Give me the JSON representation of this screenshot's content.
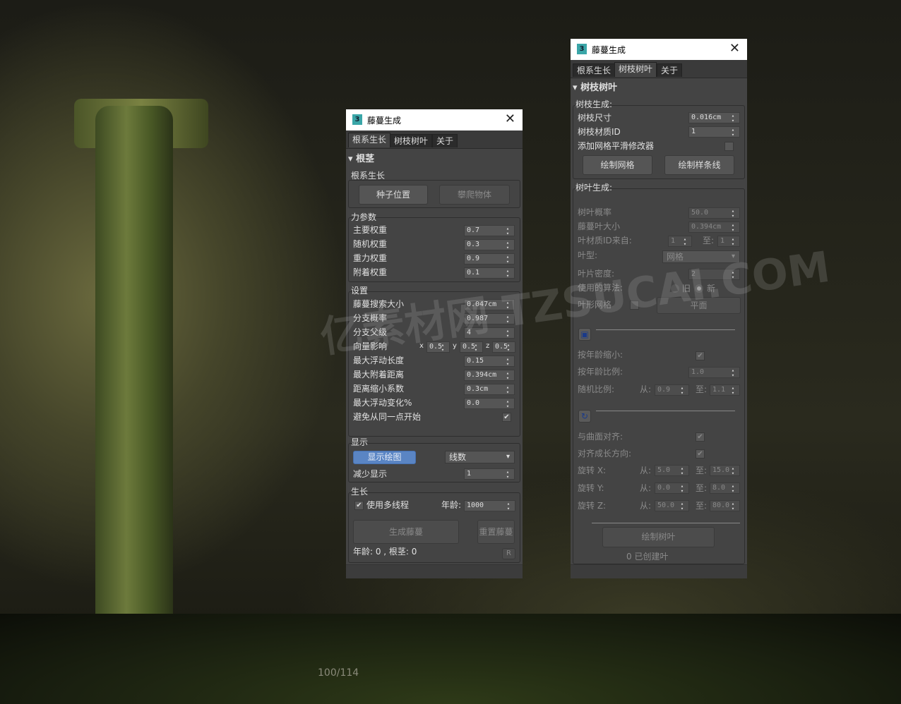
{
  "app_title": "藤蔓生成",
  "tabs": [
    "根系生长",
    "树枝树叶",
    "关于"
  ],
  "left": {
    "rollout": "根茎",
    "root_group": "根系生长",
    "seed_btn": "种子位置",
    "climb_btn": "攀爬物体",
    "force_group": "力参数",
    "force": [
      {
        "label": "主要权重",
        "value": "0.7"
      },
      {
        "label": "随机权重",
        "value": "0.3"
      },
      {
        "label": "重力权重",
        "value": "0.9"
      },
      {
        "label": "附着权重",
        "value": "0.1"
      }
    ],
    "settings_group": "设置",
    "settings": [
      {
        "label": "藤蔓搜索大小",
        "value": "0.047cm"
      },
      {
        "label": "分支概率",
        "value": "0.987"
      },
      {
        "label": "分支父级",
        "value": "4"
      }
    ],
    "vector_label": "向量影响",
    "vx": "x",
    "vxv": "0.5",
    "vy": "y",
    "vyv": "0.5",
    "vz": "z",
    "vzv": "0.5",
    "settings2": [
      {
        "label": "最大浮动长度",
        "value": "0.15"
      },
      {
        "label": "最大附着距离",
        "value": "0.394cm"
      },
      {
        "label": "距离缩小系数",
        "value": "0.3cm"
      },
      {
        "label": "最大浮动变化%",
        "value": "0.0"
      }
    ],
    "avoid_label": "避免从同一点开始",
    "avoid_checked": "✔",
    "display_group": "显示",
    "display_btn": "显示绘图",
    "display_mode": "线数",
    "reduce_label": "减少显示",
    "reduce_value": "1",
    "growth_group": "生长",
    "multithread_label": "使用多线程",
    "multithread_check": "✔",
    "age_label": "年龄:",
    "age_value": "1000",
    "gen_btn": "生成藤蔓",
    "reset_btn": "重置藤蔓",
    "status": "年龄: 0 , 根茎: 0",
    "r_btn": "R"
  },
  "right": {
    "rollout": "树枝树叶",
    "branch_group": "树枝生成:",
    "branch_size_label": "树枝尺寸",
    "branch_size": "0.016cm",
    "branch_mat_label": "树枝材质ID",
    "branch_mat": "1",
    "smooth_label": "添加网格平滑修改器",
    "draw_mesh": "绘制网格",
    "draw_spline": "绘制样条线",
    "leaf_group": "树叶生成:",
    "leaf_prob_label": "树叶概率",
    "leaf_prob": "50.0",
    "leaf_size_label": "藤蔓叶大小",
    "leaf_size": "0.394cm",
    "leaf_mat_label": "叶材质ID来自:",
    "leaf_mat_from": "1",
    "to": "至:",
    "leaf_mat_to": "1",
    "leaf_type_label": "叶型:",
    "leaf_type": "网格",
    "leaf_density_label": "叶片密度:",
    "leaf_density": "2",
    "algo_label": "使用的算法:",
    "algo_old": "旧",
    "algo_new": "新",
    "leaf_mesh_label": "叶形网格",
    "plane_btn": "平面",
    "scale_age_label": "按年龄缩小:",
    "check": "✔",
    "age_ratio_label": "按年龄比例:",
    "age_ratio": "1.0",
    "rand_ratio_label": "随机比例:",
    "from": "从:",
    "rand_from": "0.9",
    "rand_to": "1.1",
    "align_surface_label": "与曲面对齐:",
    "align_growth_label": "对齐成长方向:",
    "rot": [
      {
        "label": "旋转 X:",
        "from": "5.0",
        "to": "15.0"
      },
      {
        "label": "旋转 Y:",
        "from": "0.0",
        "to": "8.0"
      },
      {
        "label": "旋转 Z:",
        "from": "50.0",
        "to": "80.0"
      }
    ],
    "draw_leaves": "绘制树叶",
    "created": "0 已创建叶"
  },
  "page_counter": "100/114",
  "watermark": "亿素材网 TZSUCAI.COM"
}
